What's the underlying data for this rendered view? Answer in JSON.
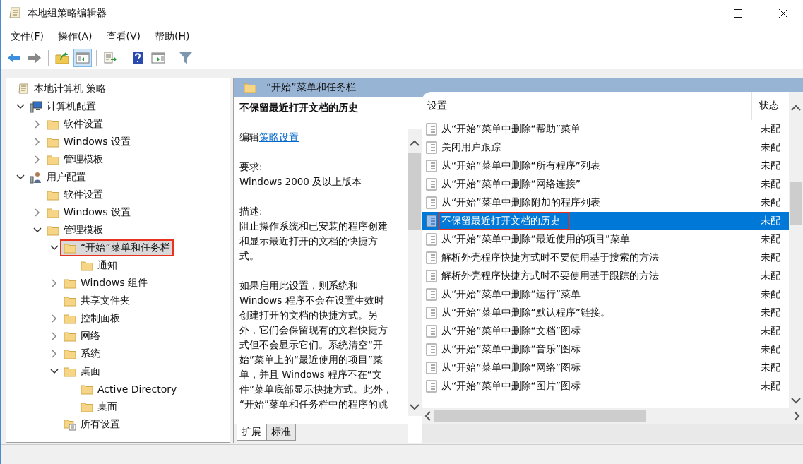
{
  "window": {
    "title": "本地组策略编辑器"
  },
  "menu": [
    "文件(F)",
    "操作(A)",
    "查看(V)",
    "帮助(H)"
  ],
  "toolbar": [
    {
      "kind": "back",
      "pressed": false
    },
    {
      "kind": "forward",
      "pressed": false
    },
    {
      "kind": "sep"
    },
    {
      "kind": "up",
      "pressed": false
    },
    {
      "kind": "tree",
      "pressed": true
    },
    {
      "kind": "sep"
    },
    {
      "kind": "export",
      "pressed": false
    },
    {
      "kind": "sep"
    },
    {
      "kind": "help",
      "pressed": false
    },
    {
      "kind": "pane",
      "pressed": false
    },
    {
      "kind": "sep"
    },
    {
      "kind": "filter",
      "pressed": false
    }
  ],
  "tree": {
    "label": "本地计算机 策略",
    "kind": "policy",
    "selected": false,
    "annotated": false,
    "children": [
      {
        "label": "计算机配置",
        "kind": "computer",
        "expanded": true,
        "selected": false,
        "annotated": false,
        "children": [
          {
            "label": "软件设置",
            "kind": "folder",
            "expanded": false,
            "selected": false,
            "annotated": false
          },
          {
            "label": "Windows 设置",
            "kind": "folder",
            "expanded": false,
            "selected": false,
            "annotated": false
          },
          {
            "label": "管理模板",
            "kind": "folder",
            "expanded": false,
            "selected": false,
            "annotated": false
          }
        ]
      },
      {
        "label": "用户配置",
        "kind": "user",
        "expanded": true,
        "selected": false,
        "annotated": false,
        "children": [
          {
            "label": "软件设置",
            "kind": "folder",
            "selected": false,
            "annotated": false
          },
          {
            "label": "Windows 设置",
            "kind": "folder",
            "expanded": false,
            "selected": false,
            "annotated": false
          },
          {
            "label": "管理模板",
            "kind": "folder",
            "expanded": true,
            "selected": false,
            "annotated": false,
            "children": [
              {
                "label": "“开始”菜单和任务栏",
                "kind": "folder",
                "expanded": true,
                "selected": true,
                "annotated": true,
                "children": [
                  {
                    "label": "通知",
                    "kind": "folder",
                    "selected": false,
                    "annotated": false
                  }
                ]
              },
              {
                "label": "Windows 组件",
                "kind": "folder",
                "expanded": false,
                "selected": false,
                "annotated": false
              },
              {
                "label": "共享文件夹",
                "kind": "folder",
                "selected": false,
                "annotated": false
              },
              {
                "label": "控制面板",
                "kind": "folder",
                "expanded": false,
                "selected": false,
                "annotated": false
              },
              {
                "label": "网络",
                "kind": "folder",
                "expanded": false,
                "selected": false,
                "annotated": false
              },
              {
                "label": "系统",
                "kind": "folder",
                "expanded": false,
                "selected": false,
                "annotated": false
              },
              {
                "label": "桌面",
                "kind": "folder",
                "expanded": true,
                "selected": false,
                "annotated": false,
                "children": [
                  {
                    "label": "Active Directory",
                    "kind": "folder",
                    "selected": false,
                    "annotated": false
                  },
                  {
                    "label": "桌面",
                    "kind": "folder",
                    "selected": false,
                    "annotated": false
                  }
                ]
              },
              {
                "label": "所有设置",
                "kind": "all-settings",
                "selected": false,
                "annotated": false
              }
            ]
          }
        ]
      }
    ]
  },
  "header": {
    "title": "“开始”菜单和任务栏"
  },
  "description": {
    "title": "不保留最近打开文档的历史",
    "edit_prefix": "编辑",
    "edit_link": "策略设置",
    "requirements_label": "要求:",
    "requirements": "Windows 2000 及以上版本",
    "description_label": "描述:",
    "summary_lines": [
      "阻止操作系统和已安装的程序创建",
      "和显示最近打开的文档的快捷方",
      "式。"
    ],
    "detail_lines": [
      "如果启用此设置，则系统和",
      "Windows 程序不会在设置生效时",
      "创建打开的文档的快捷方式。另",
      "外，它们会保留现有的文档快捷方",
      "式但不会显示它们。系统清空“开",
      "始”菜单上的“最近使用的项目”菜",
      "单，并且 Windows 程序不在“文",
      "件”菜单底部显示快捷方式。此外，",
      "“开始”菜单和任务栏中的程序的跳"
    ]
  },
  "tabs": [
    {
      "label": "扩展",
      "selected": true
    },
    {
      "label": "标准",
      "selected": false
    }
  ],
  "table": {
    "columns": [
      "设置",
      "状态"
    ],
    "rows": [
      {
        "name": "从“开始”菜单中删除“帮助”菜单",
        "state": "未配",
        "selected": false,
        "annotated": false
      },
      {
        "name": "关闭用户跟踪",
        "state": "未配",
        "selected": false,
        "annotated": false
      },
      {
        "name": "从“开始”菜单中删除“所有程序”列表",
        "state": "未配",
        "selected": false,
        "annotated": false
      },
      {
        "name": "从“开始”菜单中删除“网络连接”",
        "state": "未配",
        "selected": false,
        "annotated": false
      },
      {
        "name": "从“开始”菜单中删除附加的程序列表",
        "state": "未配",
        "selected": false,
        "annotated": false
      },
      {
        "name": "不保留最近打开文档的历史",
        "state": "未配",
        "selected": true,
        "annotated": true
      },
      {
        "name": "从“开始”菜单中删除“最近使用的项目”菜单",
        "state": "未配",
        "selected": false,
        "annotated": false
      },
      {
        "name": "解析外壳程序快捷方式时不要使用基于搜索的方法",
        "state": "未配",
        "selected": false,
        "annotated": false
      },
      {
        "name": "解析外壳程序快捷方式时不要使用基于跟踪的方法",
        "state": "未配",
        "selected": false,
        "annotated": false
      },
      {
        "name": "从“开始”菜单中删除“运行”菜单",
        "state": "未配",
        "selected": false,
        "annotated": false
      },
      {
        "name": "从“开始”菜单中删除“默认程序”链接。",
        "state": "未配",
        "selected": false,
        "annotated": false
      },
      {
        "name": "从“开始”菜单中删除“文档”图标",
        "state": "未配",
        "selected": false,
        "annotated": false
      },
      {
        "name": "从“开始”菜单中删除“音乐”图标",
        "state": "未配",
        "selected": false,
        "annotated": false
      },
      {
        "name": "从“开始”菜单中删除“网络”图标",
        "state": "未配",
        "selected": false,
        "annotated": false
      },
      {
        "name": "从“开始”菜单中删除“图片”图标",
        "state": "未配",
        "selected": false,
        "annotated": false
      }
    ]
  }
}
